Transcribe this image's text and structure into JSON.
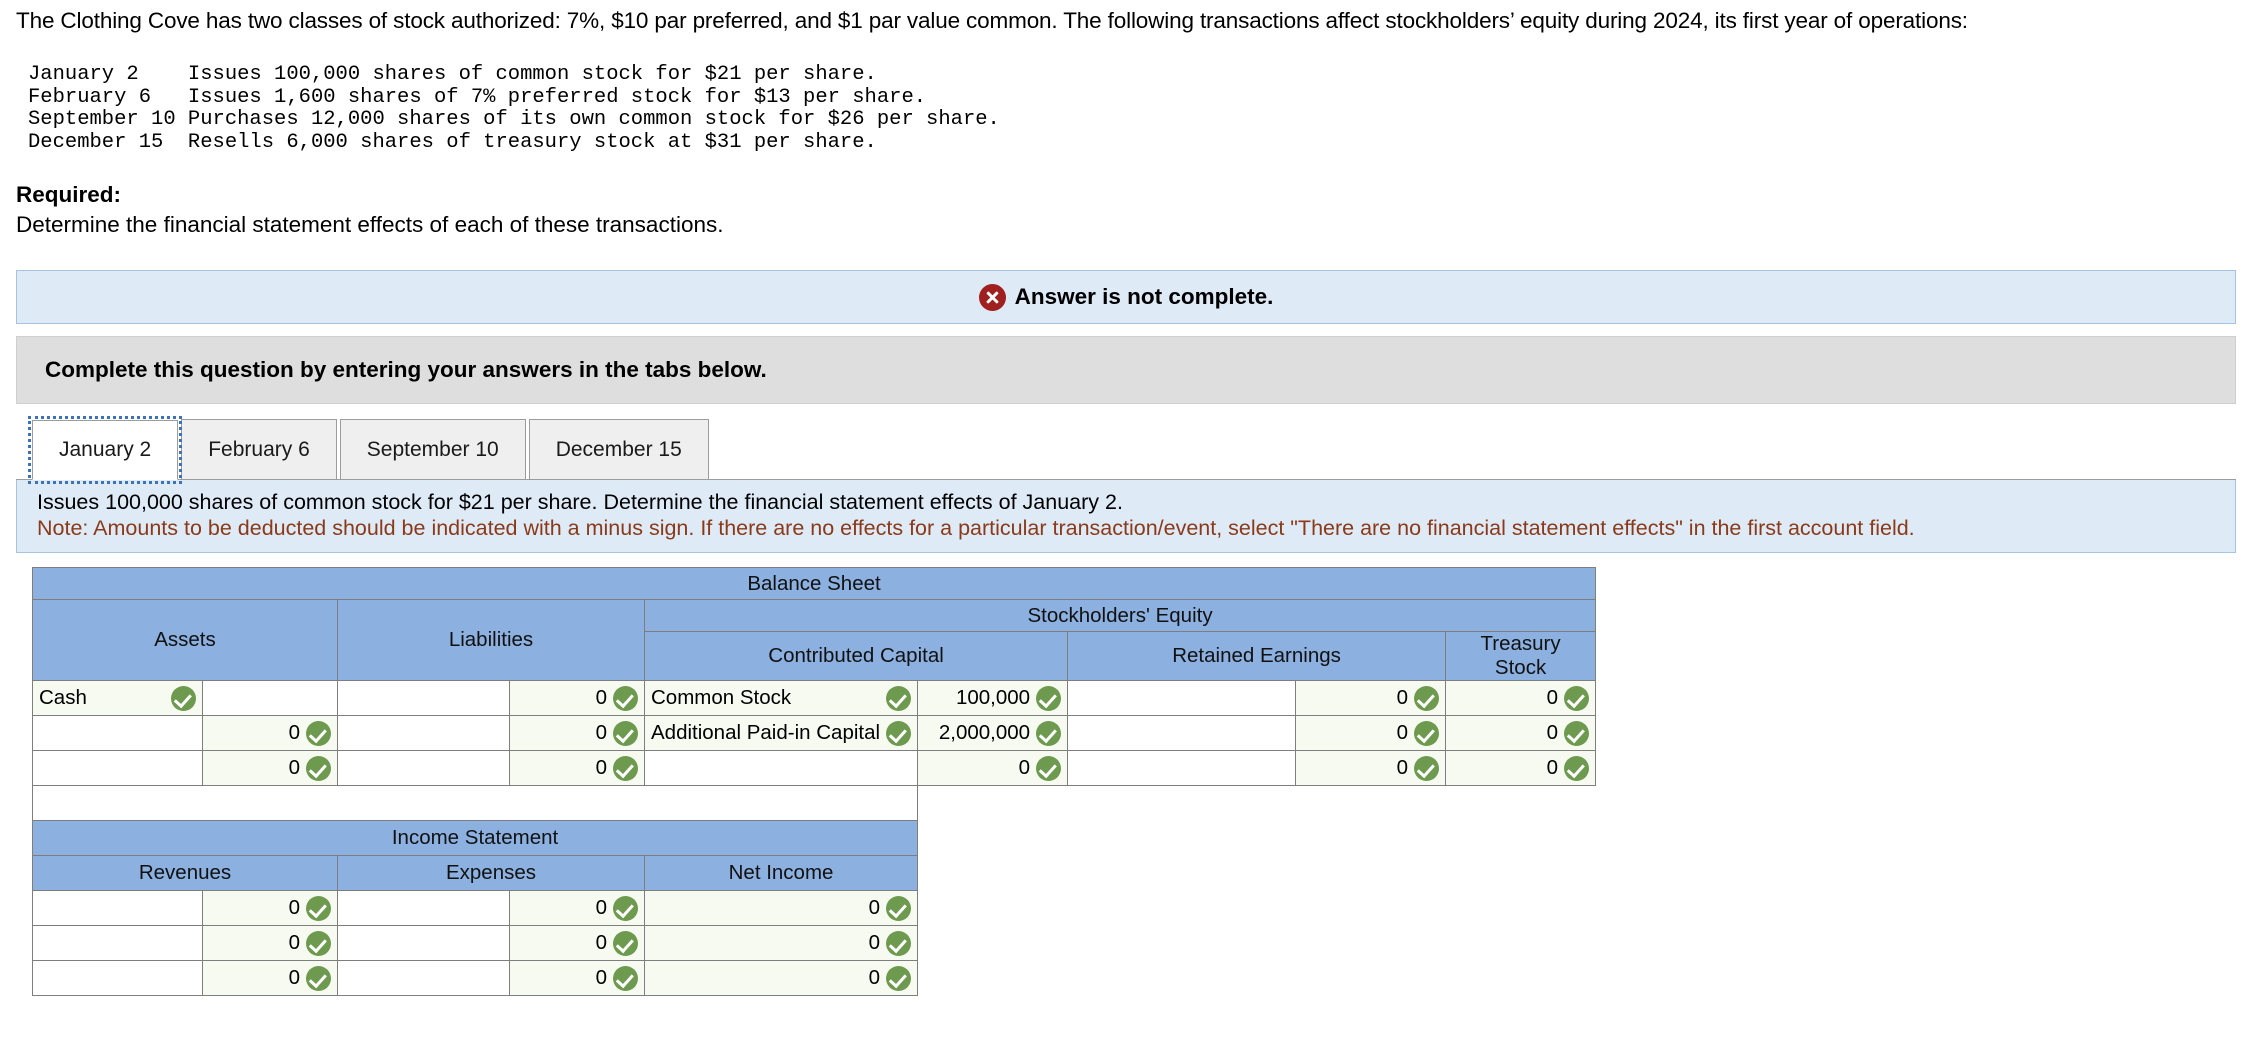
{
  "intro": {
    "paragraph": "The Clothing Cove has two classes of stock authorized: 7%, $10 par preferred, and $1 par value common. The following transactions affect stockholders’ equity during 2024, its first year of operations:",
    "transactions_text": "January 2    Issues 100,000 shares of common stock for $21 per share.\nFebruary 6   Issues 1,600 shares of 7% preferred stock for $13 per share.\nSeptember 10 Purchases 12,000 shares of its own common stock for $26 per share.\nDecember 15  Resells 6,000 shares of treasury stock at $31 per share.",
    "required_label": "Required:",
    "required_text": "Determine the financial statement effects of each of these transactions."
  },
  "alert": {
    "icon": "error-circle-x-icon",
    "message": "Answer is not complete.",
    "icon_color": "#a01f1f",
    "background": "#dfeaf7"
  },
  "instruction_bar": {
    "text": "Complete this question by entering your answers in the tabs below."
  },
  "tabs": {
    "active_index": 0,
    "items": [
      {
        "label": "January 2"
      },
      {
        "label": "February 6"
      },
      {
        "label": "September 10"
      },
      {
        "label": "December 15"
      }
    ]
  },
  "prompt": {
    "line1": "Issues 100,000 shares of common stock for $21 per share. Determine the financial statement effects of January 2.",
    "note": "Note: Amounts to be deducted should be indicated with a minus sign. If there are no effects for a particular transaction/event, select \"There are no financial statement effects\" in the first account field.",
    "note_color": "#8a3a18"
  },
  "balance_sheet": {
    "title": "Balance Sheet",
    "headers": {
      "assets": "Assets",
      "liabilities": "Liabilities",
      "stockholders_equity": "Stockholders' Equity",
      "contributed_capital": "Contributed Capital",
      "retained_earnings": "Retained Earnings",
      "treasury_stock": "Treasury Stock"
    },
    "rows": [
      {
        "asset_account": "Cash",
        "asset_amount": "",
        "liability_account": "",
        "liability_amount": "0",
        "cc_account": "Common Stock",
        "cc_amount": "100,000",
        "re_account": "",
        "re_amount": "0",
        "ts_amount": "0"
      },
      {
        "asset_account": "",
        "asset_amount": "0",
        "liability_account": "",
        "liability_amount": "0",
        "cc_account": "Additional Paid-in Capital",
        "cc_amount": "2,000,000",
        "re_account": "",
        "re_amount": "0",
        "ts_amount": "0"
      },
      {
        "asset_account": "",
        "asset_amount": "0",
        "liability_account": "",
        "liability_amount": "0",
        "cc_account": "",
        "cc_amount": "0",
        "re_account": "",
        "re_amount": "0",
        "ts_amount": "0"
      }
    ]
  },
  "income_statement": {
    "title": "Income Statement",
    "headers": {
      "revenues": "Revenues",
      "expenses": "Expenses",
      "net_income": "Net Income"
    },
    "rows": [
      {
        "rev_account": "",
        "rev_amount": "0",
        "exp_account": "",
        "exp_amount": "0",
        "ni_amount": "0"
      },
      {
        "rev_account": "",
        "rev_amount": "0",
        "exp_account": "",
        "exp_amount": "0",
        "ni_amount": "0"
      },
      {
        "rev_account": "",
        "rev_amount": "0",
        "exp_account": "",
        "exp_amount": "0",
        "ni_amount": "0"
      }
    ]
  }
}
